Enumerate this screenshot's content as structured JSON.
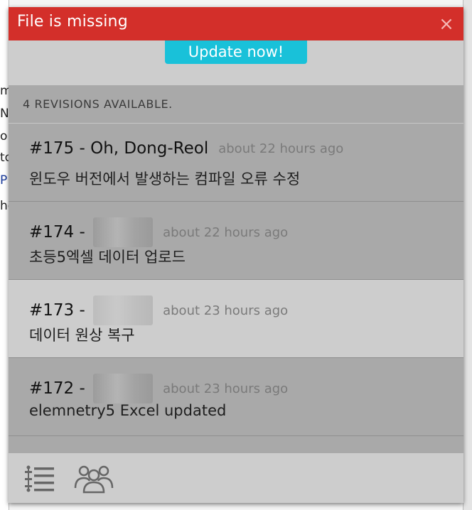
{
  "background": {
    "fragments": [
      "m",
      "N",
      "o",
      "to",
      "P",
      "he"
    ]
  },
  "dialog": {
    "title": "File is missing",
    "close_glyph": "×",
    "update_button": "Update now!",
    "revisions_header": "4 REVISIONS AVAILABLE.",
    "revisions": [
      {
        "number": "#175 - ",
        "author": "Oh, Dong-Reol",
        "time": "about 22 hours ago",
        "message": "윈도우 버전에서 발생하는 컴파일 오류 수정",
        "author_hidden": false
      },
      {
        "number": "#174 - ",
        "author": "",
        "time": "about 22 hours ago",
        "message": "초등5엑셀 데이터 업로드",
        "author_hidden": true
      },
      {
        "number": "#173 - ",
        "author": "",
        "time": "about 23 hours ago",
        "message": "데이터 원상 복구",
        "author_hidden": true
      },
      {
        "number": "#172 - ",
        "author": "",
        "time": "about 23 hours ago",
        "message": "elemnetry5 Excel updated",
        "author_hidden": true
      }
    ],
    "footer_icons": [
      "list-icon",
      "users-icon"
    ]
  },
  "colors": {
    "title_bar": "#d32f2a",
    "update_button": "#19c1d9",
    "selected_row": "#cdcdcd",
    "row": "#a9a9a9"
  }
}
